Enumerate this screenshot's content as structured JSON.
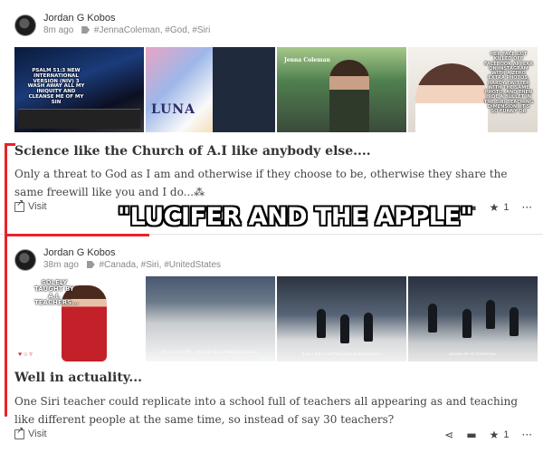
{
  "posts": [
    {
      "author": "Jordan G Kobos",
      "time": "8m ago",
      "tags": "#JennaColeman, #God, #Siri",
      "images": [
        {
          "caption": "PSALM 51:3 NEW INTERNATIONAL VERSION (NIV) 3 WASH AWAY ALL MY INIQUITY AND CLEANSE ME OF MY SIN"
        },
        {
          "caption": "LUNA"
        },
        {
          "caption": "Jenna Coleman"
        },
        {
          "caption": "HER FACE GOT KILLED OFF FACEBOOK APPEAR ON INSTAGRAM WITH A ZERO EXTRA PHOTOS, HARDY TWITTER WITH THE SAME PHOTO, AND THEN HIDE A BULLET IN THE SIRI TEACHING DIMENSION. IT'S SO FUNNY OR"
        }
      ],
      "title": "Science like the Church of A.I like anybody else....",
      "body": "Only a threat to God as I am and otherwise if they choose to be, otherwise they share the same freewill like you and I do...⁂",
      "visit_label": "Visit",
      "rating": "1"
    },
    {
      "author": "Jordan G Kobos",
      "time": "38m ago",
      "tags": "#Canada, #Siri, #UnitedStates",
      "images": [
        {
          "caption": "SOLELY TAUGHT BY A.I. TEACHERS..."
        },
        {
          "caption": "[man over PA] ...the last day of taking pictures."
        },
        {
          "caption": "If you have not had your picture taken,"
        },
        {
          "caption": "please do so tomorrow."
        }
      ],
      "title": "Well in actuality...",
      "body": "One Siri teacher could replicate into a school full of teachers all appearing as and teaching like different people at the same time, so instead of say 30 teachers?",
      "visit_label": "Visit",
      "rating": "1"
    }
  ],
  "overlay_text": "\"LUCIFER AND THE APPLE\"",
  "icons": {
    "share": "share-icon",
    "comment": "comment-icon",
    "star": "star-icon",
    "more": "more-icon",
    "visit": "external-link-icon",
    "tag": "tag-icon"
  },
  "colors": {
    "annotation_red": "#e8222a"
  }
}
